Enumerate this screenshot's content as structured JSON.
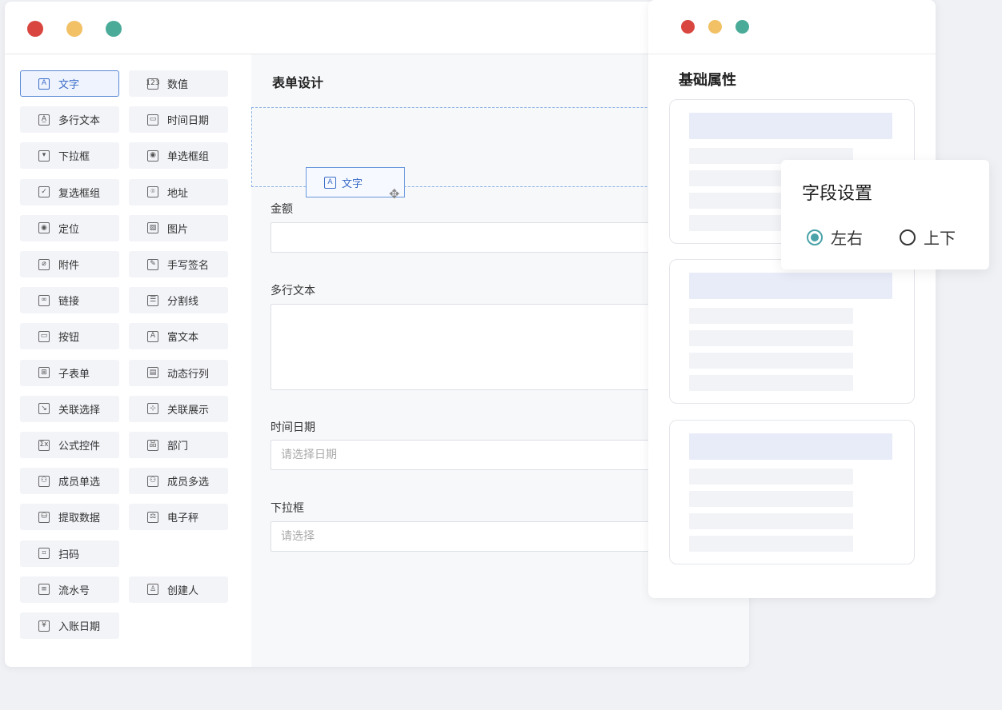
{
  "colors": {
    "accent": "#3b6cc8",
    "close": "#d8463f",
    "minimize": "#f2c166",
    "maximize": "#4aab99",
    "radio_accent": "#4aa3a8"
  },
  "palette": {
    "items": [
      {
        "label": "文字",
        "icon": "A",
        "icon_name": "text-icon"
      },
      {
        "label": "数值",
        "icon": "123",
        "icon_name": "number-icon"
      },
      {
        "label": "多行文本",
        "icon": "A̲",
        "icon_name": "multiline-text-icon"
      },
      {
        "label": "时间日期",
        "icon": "▭",
        "icon_name": "calendar-icon"
      },
      {
        "label": "下拉框",
        "icon": "▾",
        "icon_name": "dropdown-icon"
      },
      {
        "label": "单选框组",
        "icon": "◉",
        "icon_name": "radio-icon"
      },
      {
        "label": "复选框组",
        "icon": "✓",
        "icon_name": "checkbox-icon"
      },
      {
        "label": "地址",
        "icon": "⌾",
        "icon_name": "location-pin-icon"
      },
      {
        "label": "定位",
        "icon": "◉",
        "icon_name": "locate-icon"
      },
      {
        "label": "图片",
        "icon": "▨",
        "icon_name": "image-icon"
      },
      {
        "label": "附件",
        "icon": "⌀",
        "icon_name": "paperclip-icon"
      },
      {
        "label": "手写签名",
        "icon": "✎",
        "icon_name": "signature-icon"
      },
      {
        "label": "链接",
        "icon": "∞",
        "icon_name": "link-icon"
      },
      {
        "label": "分割线",
        "icon": "☰",
        "icon_name": "divider-icon"
      },
      {
        "label": "按钮",
        "icon": "▭",
        "icon_name": "button-icon"
      },
      {
        "label": "富文本",
        "icon": "A",
        "icon_name": "rich-text-icon"
      },
      {
        "label": "子表单",
        "icon": "⊞",
        "icon_name": "subform-icon"
      },
      {
        "label": "动态行列",
        "icon": "▤",
        "icon_name": "dynamic-table-icon"
      },
      {
        "label": "关联选择",
        "icon": "↘",
        "icon_name": "relation-select-icon"
      },
      {
        "label": "关联展示",
        "icon": "⊹",
        "icon_name": "relation-display-icon"
      },
      {
        "label": "公式控件",
        "icon": "Σx",
        "icon_name": "formula-icon"
      },
      {
        "label": "部门",
        "icon": "品",
        "icon_name": "department-icon"
      },
      {
        "label": "成员单选",
        "icon": "⚇",
        "icon_name": "member-single-icon"
      },
      {
        "label": "成员多选",
        "icon": "⚇",
        "icon_name": "member-multi-icon"
      },
      {
        "label": "提取数据",
        "icon": "⛁",
        "icon_name": "extract-data-icon"
      },
      {
        "label": "电子秤",
        "icon": "⚖",
        "icon_name": "scale-icon"
      },
      {
        "label": "扫码",
        "icon": "⌗",
        "icon_name": "scan-icon"
      },
      {
        "label": "流水号",
        "icon": "≡",
        "icon_name": "serial-number-icon"
      },
      {
        "label": "创建人",
        "icon": "♙",
        "icon_name": "creator-icon"
      },
      {
        "label": "入账日期",
        "icon": "¥",
        "icon_name": "posting-date-icon"
      }
    ]
  },
  "canvas": {
    "title": "表单设计",
    "drag_chip": {
      "label": "文字",
      "icon": "A"
    },
    "fields": [
      {
        "label": "金额",
        "placeholder": ""
      },
      {
        "label": "多行文本",
        "placeholder": ""
      },
      {
        "label": "时间日期",
        "placeholder": "请选择日期"
      },
      {
        "label": "下拉框",
        "placeholder": "请选择"
      }
    ]
  },
  "properties": {
    "title": "基础属性"
  },
  "popup": {
    "title": "字段设置",
    "options": [
      {
        "label": "左右",
        "checked": true
      },
      {
        "label": "上下",
        "checked": false
      }
    ]
  }
}
